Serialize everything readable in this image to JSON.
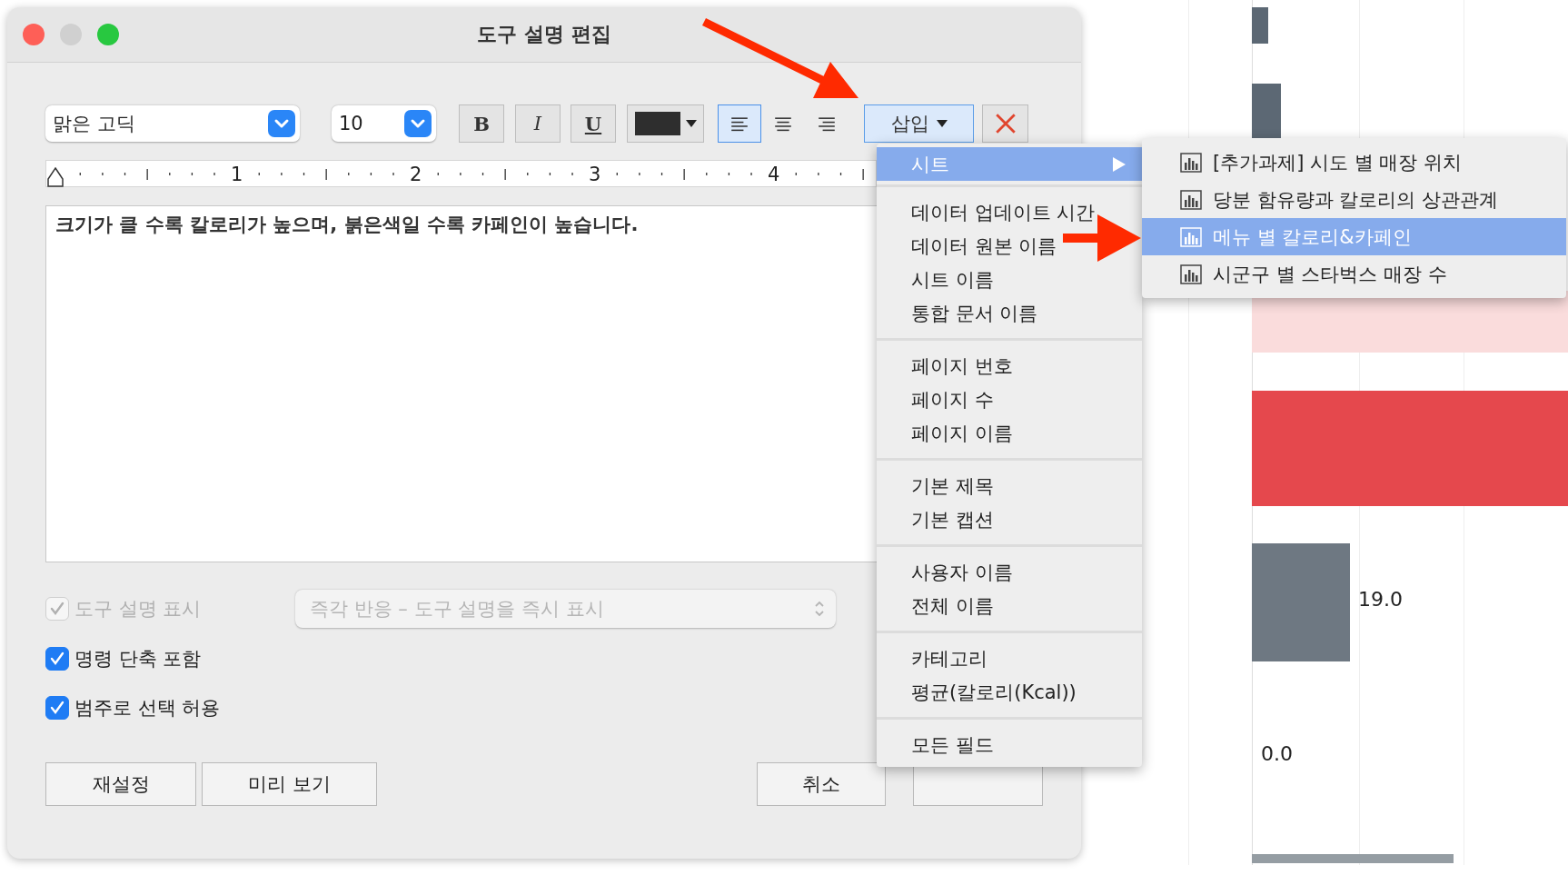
{
  "window": {
    "title": "도구 설명 편집"
  },
  "toolbar": {
    "font": "맑은 고딕",
    "size": "10",
    "bold": "B",
    "italic": "I",
    "underline": "U",
    "insert_button": "삽입",
    "align": [
      {
        "kind": "left",
        "selected": true
      },
      {
        "kind": "center",
        "selected": false
      },
      {
        "kind": "right",
        "selected": false
      }
    ]
  },
  "ruler": {
    "labels": [
      "1",
      "2",
      "3",
      "4"
    ]
  },
  "editor": {
    "value": "크기가 클 수록 칼로리가 높으며, 붉은색일 수록 카페인이 높습니다."
  },
  "show_tooltip": {
    "label": "도구 설명 표시",
    "checked": true,
    "disabled": true
  },
  "display_mode": {
    "value": "즉각 반응 – 도구 설명을 즉시 표시",
    "disabled": true
  },
  "options": [
    {
      "label": "명령 단축 포함",
      "checked": true
    },
    {
      "label": "범주로 선택 허용",
      "checked": true
    }
  ],
  "buttons": [
    "재설정",
    "미리 보기"
  ],
  "cancel_button": "취소",
  "insert_menu": [
    [
      {
        "label": "시트",
        "kind": "submenu",
        "selected": true
      }
    ],
    [
      {
        "label": "데이터 업데이트 시간",
        "kind": "item",
        "selected": false
      },
      {
        "label": "데이터 원본 이름",
        "kind": "item",
        "selected": false
      },
      {
        "label": "시트 이름",
        "kind": "item",
        "selected": false
      },
      {
        "label": "통합 문서 이름",
        "kind": "item",
        "selected": false
      }
    ],
    [
      {
        "label": "페이지 번호",
        "kind": "item",
        "selected": false
      },
      {
        "label": "페이지 수",
        "kind": "item",
        "selected": false
      },
      {
        "label": "페이지 이름",
        "kind": "item",
        "selected": false
      }
    ],
    [
      {
        "label": "기본 제목",
        "kind": "item",
        "selected": false
      },
      {
        "label": "기본 캡션",
        "kind": "item",
        "selected": false
      }
    ],
    [
      {
        "label": "사용자 이름",
        "kind": "item",
        "selected": false
      },
      {
        "label": "전체 이름",
        "kind": "item",
        "selected": false
      }
    ],
    [
      {
        "label": "카테고리",
        "kind": "item",
        "selected": false
      },
      {
        "label": "평균(칼로리(Kcal))",
        "kind": "item",
        "selected": false
      }
    ],
    [
      {
        "label": "모든 필드",
        "kind": "item",
        "selected": false
      }
    ]
  ],
  "sheet_submenu": [
    {
      "label": "[추가과제] 시도 별 매장 위치",
      "selected": false
    },
    {
      "label": "당분 함유량과 칼로리의 상관관계",
      "selected": false
    },
    {
      "label": "메뉴 별 칼로리&카페인",
      "selected": true
    },
    {
      "label": "시군구 별 스타벅스 매장 수",
      "selected": false
    }
  ],
  "background_chart": {
    "value_labels": [
      "19.0",
      "0.0"
    ]
  }
}
